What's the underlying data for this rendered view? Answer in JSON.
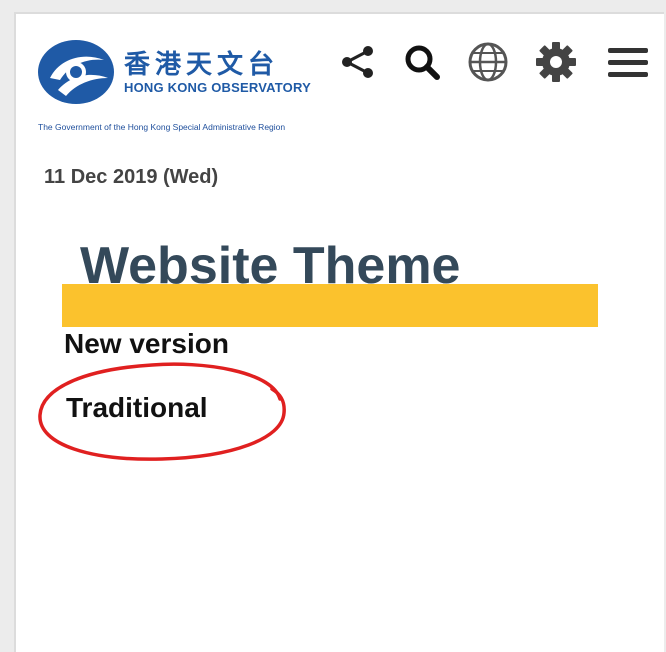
{
  "header": {
    "logo_chinese": "香港天文台",
    "logo_english": "HONG KONG OBSERVATORY",
    "government_line": "The Government of the Hong Kong Special Administrative Region"
  },
  "toolbar": {
    "icons": [
      "share-icon",
      "search-icon",
      "globe-icon",
      "gear-icon",
      "menu-icon"
    ]
  },
  "date_text": "11 Dec 2019 (Wed)",
  "theme": {
    "title": "Website Theme",
    "options": [
      "New version",
      "Traditional"
    ]
  },
  "colors": {
    "accent_bar": "#fbc22d",
    "title": "#34495a",
    "logo_blue": "#1f5aa6",
    "highlight_circle": "#e02020"
  }
}
